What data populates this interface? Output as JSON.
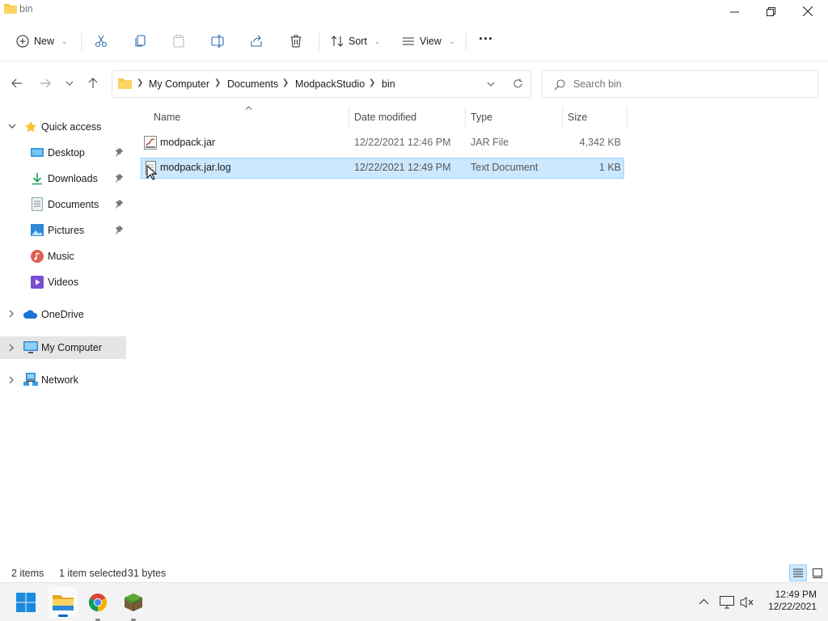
{
  "window": {
    "title": "bin"
  },
  "toolbar": {
    "new_label": "New",
    "sort_label": "Sort",
    "view_label": "View",
    "more_label": "···"
  },
  "address": {
    "crumbs": [
      "My Computer",
      "Documents",
      "ModpackStudio",
      "bin"
    ]
  },
  "search": {
    "placeholder": "Search bin"
  },
  "sidebar": {
    "quick_access": "Quick access",
    "items": [
      {
        "label": "Desktop",
        "icon": "desktop-icon"
      },
      {
        "label": "Downloads",
        "icon": "downloads-icon"
      },
      {
        "label": "Documents",
        "icon": "documents-icon"
      },
      {
        "label": "Pictures",
        "icon": "pictures-icon"
      },
      {
        "label": "Music",
        "icon": "music-icon"
      },
      {
        "label": "Videos",
        "icon": "videos-icon"
      }
    ],
    "onedrive": "OneDrive",
    "my_computer": "My Computer",
    "network": "Network"
  },
  "columns": {
    "name": "Name",
    "date": "Date modified",
    "type": "Type",
    "size": "Size"
  },
  "files": [
    {
      "name": "modpack.jar",
      "date": "12/22/2021 12:46 PM",
      "type": "JAR File",
      "size": "4,342 KB",
      "selected": false
    },
    {
      "name": "modpack.jar.log",
      "date": "12/22/2021 12:49 PM",
      "type": "Text Document",
      "size": "1 KB",
      "selected": true
    }
  ],
  "status": {
    "count": "2 items",
    "selection": "1 item selected",
    "bytes": "31 bytes"
  },
  "taskbar": {
    "time": "12:49 PM",
    "date": "12/22/2021"
  },
  "colors": {
    "accent": "#0067c0",
    "selection": "#cce8ff",
    "selection_border": "#99d1ff",
    "folder": "#f8c542"
  }
}
